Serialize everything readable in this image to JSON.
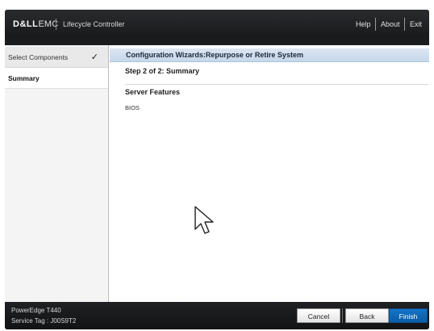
{
  "header": {
    "logo": {
      "dell": "D&LL",
      "emc": "EMC"
    },
    "app_title": "Lifecycle Controller",
    "links": {
      "help": "Help",
      "about": "About",
      "exit": "Exit"
    }
  },
  "sidebar": {
    "items": [
      {
        "label": "Select Components",
        "status": "done"
      },
      {
        "label": "Summary",
        "status": "active"
      }
    ],
    "check_glyph": "✓"
  },
  "main": {
    "title": "Configuration Wizards:Repurpose or Retire System",
    "step": "Step 2 of 2: Summary",
    "section_title": "Server Features",
    "features": [
      "BIOS"
    ]
  },
  "footer": {
    "model": "PowerEdge T440",
    "service_tag": "Service Tag : J00S9T2",
    "buttons": {
      "cancel": "Cancel",
      "back": "Back",
      "finish": "Finish"
    }
  },
  "colors": {
    "header_bg": "#1b1c1e",
    "title_bar": "#c6d7ea",
    "primary_button": "#0a5ea8"
  },
  "icons": [
    "check-icon",
    "mouse-pointer-icon"
  ]
}
